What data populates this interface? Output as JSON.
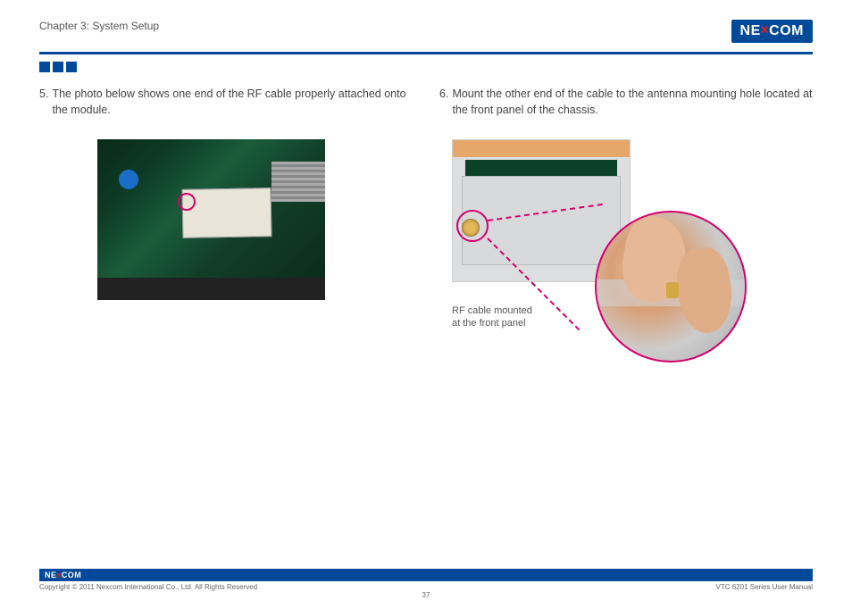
{
  "header": {
    "chapter": "Chapter 3: System Setup",
    "logo": {
      "pre": "NE",
      "x": "✕",
      "post": "COM"
    }
  },
  "left": {
    "step_num": "5.",
    "step_text": "The photo below shows one end of the RF cable properly attached onto the module."
  },
  "right": {
    "step_num": "6.",
    "step_text": "Mount the other end of the cable to the antenna mounting hole located at the front panel of the chassis.",
    "caption_line1": "RF cable mounted",
    "caption_line2": "at the front panel"
  },
  "footer": {
    "copyright": "Copyright © 2011 Nexcom International Co., Ltd. All Rights Reserved",
    "page": "37",
    "doc": "VTC 6201 Series User Manual",
    "logo": {
      "pre": "NE",
      "x": "✕",
      "post": "COM"
    }
  }
}
